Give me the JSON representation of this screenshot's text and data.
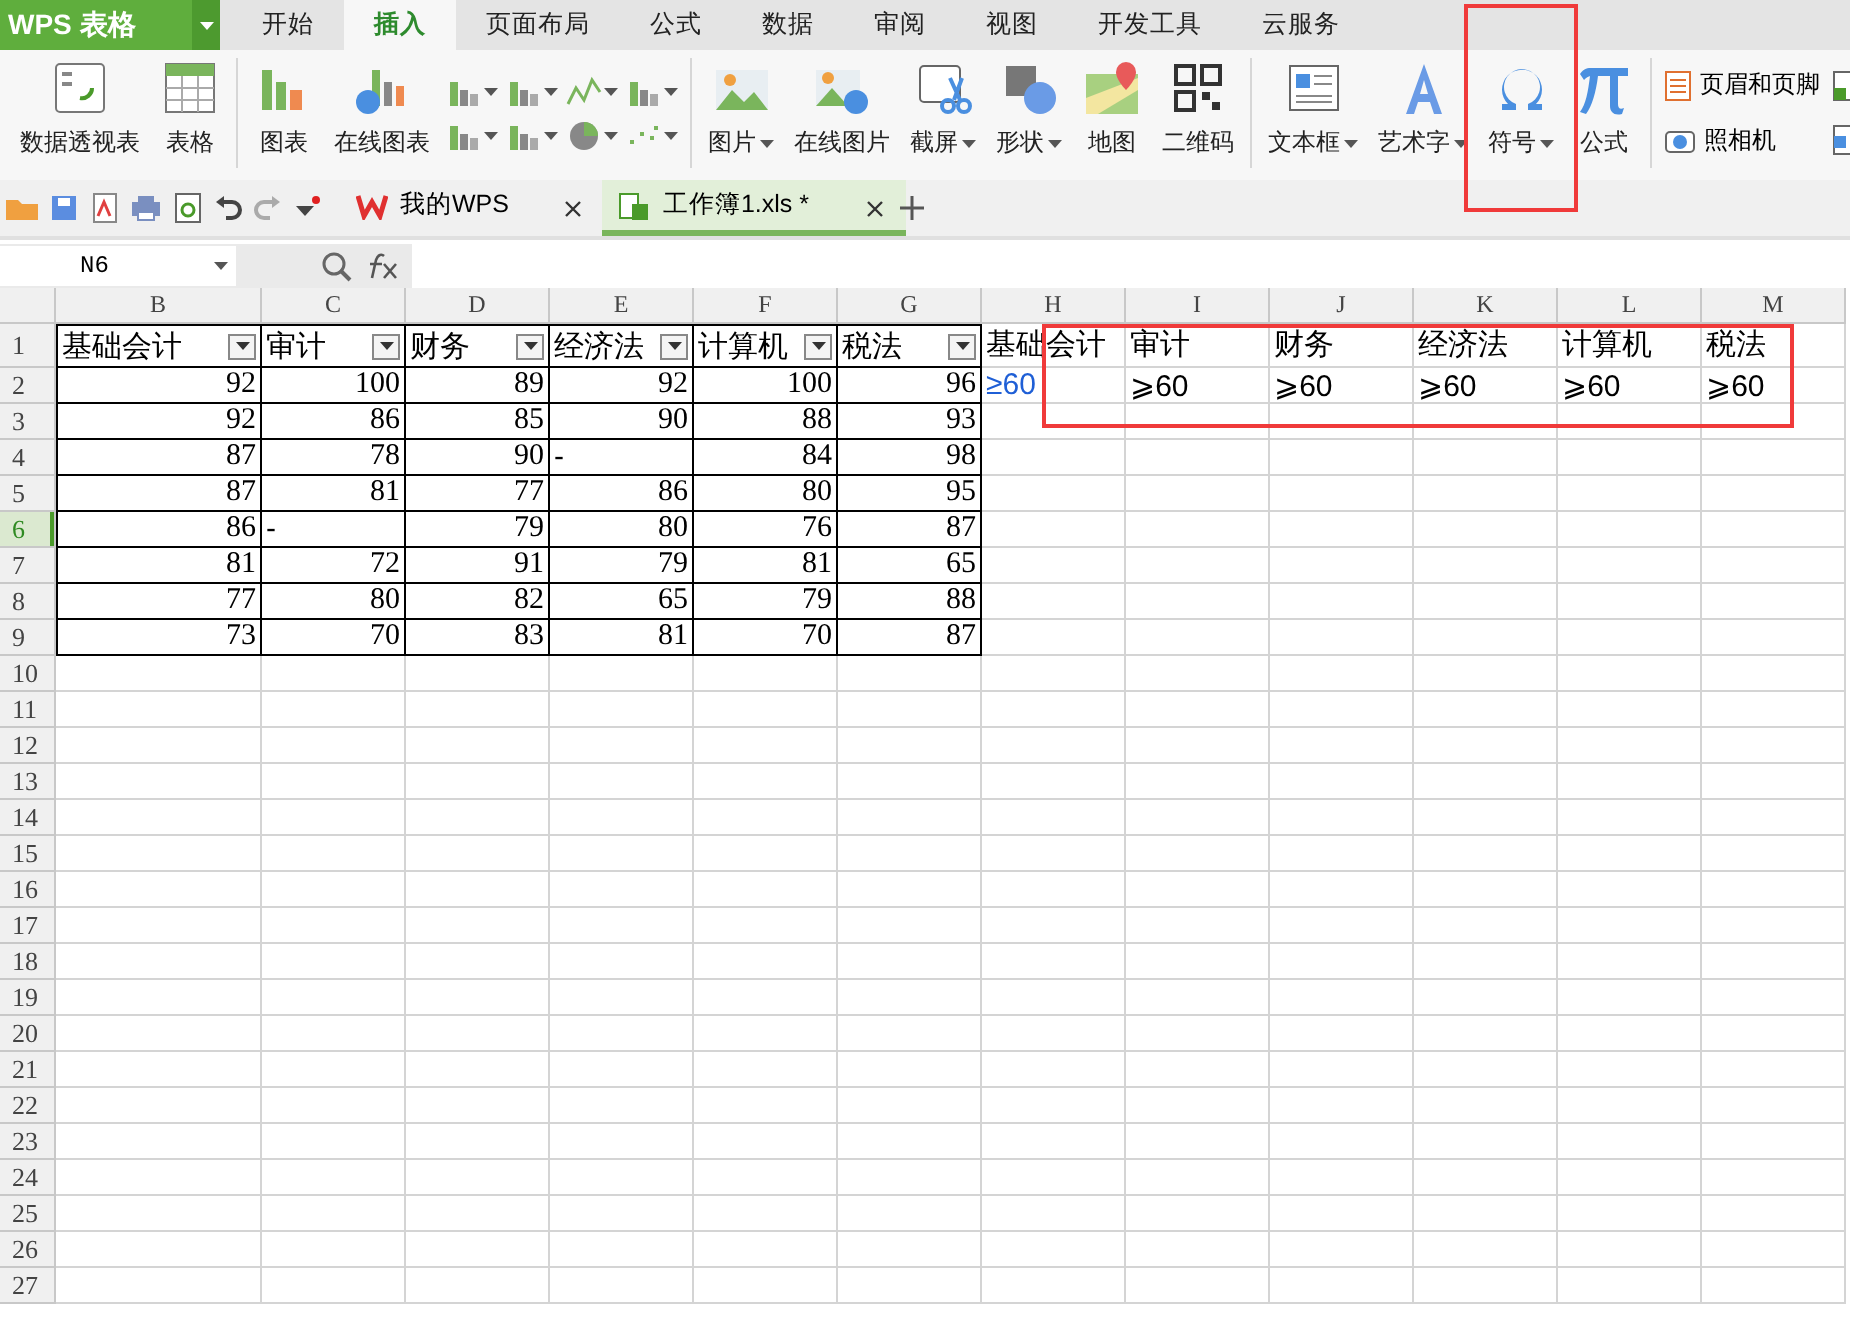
{
  "app": {
    "logo": "WPS 表格"
  },
  "menu_tabs": [
    {
      "label": "开始",
      "selected": false
    },
    {
      "label": "插入",
      "selected": true
    },
    {
      "label": "页面布局",
      "selected": false
    },
    {
      "label": "公式",
      "selected": false
    },
    {
      "label": "数据",
      "selected": false
    },
    {
      "label": "审阅",
      "selected": false
    },
    {
      "label": "视图",
      "selected": false
    },
    {
      "label": "开发工具",
      "selected": false
    },
    {
      "label": "云服务",
      "selected": false
    }
  ],
  "ribbon_groups": [
    {
      "items": [
        {
          "kind": "big",
          "label": "数据透视表",
          "caret": false,
          "highlighted": false
        },
        {
          "kind": "big",
          "label": "表格",
          "caret": false,
          "highlighted": false
        }
      ]
    },
    {
      "items": [
        {
          "kind": "big",
          "label": "图表",
          "caret": false,
          "highlighted": false
        },
        {
          "kind": "big",
          "label": "在线图表",
          "caret": false,
          "highlighted": false
        },
        {
          "kind": "mini_grid",
          "caret": true
        }
      ]
    },
    {
      "items": [
        {
          "kind": "big",
          "label": "图片",
          "caret": true,
          "highlighted": false
        },
        {
          "kind": "big",
          "label": "在线图片",
          "caret": false,
          "highlighted": false
        },
        {
          "kind": "big",
          "label": "截屏",
          "caret": true,
          "highlighted": false
        },
        {
          "kind": "big",
          "label": "形状",
          "caret": true,
          "highlighted": false
        },
        {
          "kind": "big",
          "label": "地图",
          "caret": false,
          "highlighted": false
        },
        {
          "kind": "big",
          "label": "二维码",
          "caret": false,
          "highlighted": false
        }
      ]
    },
    {
      "items": [
        {
          "kind": "big",
          "label": "文本框",
          "caret": true,
          "highlighted": false
        },
        {
          "kind": "big",
          "label": "艺术字",
          "caret": true,
          "highlighted": false
        },
        {
          "kind": "big",
          "label": "符号",
          "caret": true,
          "highlighted": true
        },
        {
          "kind": "big",
          "label": "公式",
          "caret": false,
          "highlighted": false
        }
      ]
    },
    {
      "items": [
        {
          "kind": "stack",
          "labels": [
            "页眉和页脚",
            "照相机"
          ]
        },
        {
          "kind": "stack_icons"
        }
      ]
    }
  ],
  "doc_tabs": [
    {
      "label": "我的WPS",
      "selected": false
    },
    {
      "label": "工作簿1.xls *",
      "selected": true
    }
  ],
  "formula_bar": {
    "name_box": "N6"
  },
  "sheet": {
    "columns": [
      "B",
      "C",
      "D",
      "E",
      "F",
      "G",
      "H",
      "I",
      "J",
      "K",
      "L",
      "M"
    ],
    "annotation_box": true,
    "rows": [
      {
        "number": "1",
        "selected": false,
        "cells": [
          {
            "kind": "header",
            "text": "基础会计"
          },
          {
            "kind": "header",
            "text": "审计"
          },
          {
            "kind": "header",
            "text": "财务"
          },
          {
            "kind": "header",
            "text": "经济法"
          },
          {
            "kind": "header",
            "text": "计算机"
          },
          {
            "kind": "header",
            "text": "税法"
          },
          {
            "kind": "plain",
            "text": "基础会计"
          },
          {
            "kind": "plain",
            "text": "审计"
          },
          {
            "kind": "plain",
            "text": "财务"
          },
          {
            "kind": "plain",
            "text": "经济法"
          },
          {
            "kind": "plain",
            "text": "计算机"
          },
          {
            "kind": "plain",
            "text": "税法"
          }
        ]
      },
      {
        "number": "2",
        "selected": false,
        "cells": [
          {
            "kind": "number",
            "text": "92"
          },
          {
            "kind": "number",
            "text": "100"
          },
          {
            "kind": "number",
            "text": "89"
          },
          {
            "kind": "number",
            "text": "92"
          },
          {
            "kind": "number",
            "text": "100"
          },
          {
            "kind": "number",
            "text": "96"
          },
          {
            "kind": "note",
            "text": "≥60"
          },
          {
            "kind": "plain",
            "text": "⩾60"
          },
          {
            "kind": "plain",
            "text": "⩾60"
          },
          {
            "kind": "plain",
            "text": "⩾60"
          },
          {
            "kind": "plain",
            "text": "⩾60"
          },
          {
            "kind": "plain",
            "text": "⩾60"
          }
        ]
      },
      {
        "number": "3",
        "selected": false,
        "cells": [
          {
            "kind": "number",
            "text": "92"
          },
          {
            "kind": "number",
            "text": "86"
          },
          {
            "kind": "number",
            "text": "85"
          },
          {
            "kind": "number",
            "text": "90"
          },
          {
            "kind": "number",
            "text": "88"
          },
          {
            "kind": "number",
            "text": "93"
          }
        ]
      },
      {
        "number": "4",
        "selected": false,
        "cells": [
          {
            "kind": "number",
            "text": "87"
          },
          {
            "kind": "number",
            "text": "78"
          },
          {
            "kind": "number",
            "text": "90"
          },
          {
            "kind": "text",
            "text": "-"
          },
          {
            "kind": "number",
            "text": "84"
          },
          {
            "kind": "number",
            "text": "98"
          }
        ]
      },
      {
        "number": "5",
        "selected": false,
        "cells": [
          {
            "kind": "number",
            "text": "87"
          },
          {
            "kind": "number",
            "text": "81"
          },
          {
            "kind": "number",
            "text": "77"
          },
          {
            "kind": "number",
            "text": "86"
          },
          {
            "kind": "number",
            "text": "80"
          },
          {
            "kind": "number",
            "text": "95"
          }
        ]
      },
      {
        "number": "6",
        "selected": true,
        "cells": [
          {
            "kind": "number",
            "text": "86"
          },
          {
            "kind": "text",
            "text": "-"
          },
          {
            "kind": "number",
            "text": "79"
          },
          {
            "kind": "number",
            "text": "80"
          },
          {
            "kind": "number",
            "text": "76"
          },
          {
            "kind": "number",
            "text": "87"
          }
        ]
      },
      {
        "number": "7",
        "selected": false,
        "cells": [
          {
            "kind": "number",
            "text": "81"
          },
          {
            "kind": "number",
            "text": "72"
          },
          {
            "kind": "number",
            "text": "91"
          },
          {
            "kind": "number",
            "text": "79"
          },
          {
            "kind": "number",
            "text": "81"
          },
          {
            "kind": "number",
            "text": "65"
          }
        ]
      },
      {
        "number": "8",
        "selected": false,
        "cells": [
          {
            "kind": "number",
            "text": "77"
          },
          {
            "kind": "number",
            "text": "80"
          },
          {
            "kind": "number",
            "text": "82"
          },
          {
            "kind": "number",
            "text": "65"
          },
          {
            "kind": "number",
            "text": "79"
          },
          {
            "kind": "number",
            "text": "88"
          }
        ]
      },
      {
        "number": "9",
        "selected": false,
        "cells": [
          {
            "kind": "number",
            "text": "73"
          },
          {
            "kind": "number",
            "text": "70"
          },
          {
            "kind": "number",
            "text": "83"
          },
          {
            "kind": "number",
            "text": "81"
          },
          {
            "kind": "number",
            "text": "70"
          },
          {
            "kind": "number",
            "text": "87"
          }
        ]
      },
      {
        "number": "10",
        "selected": false
      },
      {
        "number": "11",
        "selected": false
      },
      {
        "number": "12",
        "selected": false
      },
      {
        "number": "13",
        "selected": false
      },
      {
        "number": "14",
        "selected": false
      },
      {
        "number": "15",
        "selected": false
      },
      {
        "number": "16",
        "selected": false
      },
      {
        "number": "17",
        "selected": false
      },
      {
        "number": "18",
        "selected": false
      },
      {
        "number": "19",
        "selected": false
      },
      {
        "number": "20",
        "selected": false
      },
      {
        "number": "21",
        "selected": false
      },
      {
        "number": "22",
        "selected": false
      },
      {
        "number": "23",
        "selected": false
      },
      {
        "number": "24",
        "selected": false
      },
      {
        "number": "25",
        "selected": false
      },
      {
        "number": "26",
        "selected": false
      },
      {
        "number": "27",
        "selected": false
      }
    ]
  }
}
